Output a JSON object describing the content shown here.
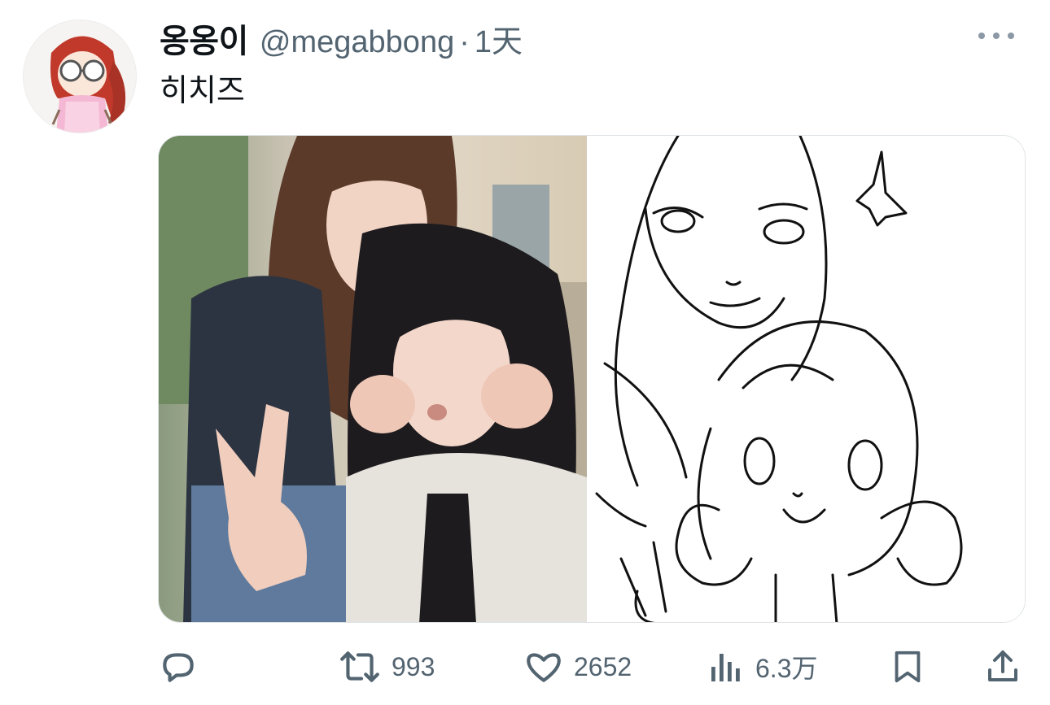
{
  "tweet": {
    "display_name": "옹옹이",
    "handle": "@megabbong",
    "separator": "·",
    "timestamp": "1天",
    "text": "히치즈"
  },
  "actions": {
    "reply": {
      "icon": "reply-icon",
      "count": ""
    },
    "retweet": {
      "icon": "retweet-icon",
      "count": "993"
    },
    "like": {
      "icon": "heart-icon",
      "count": "2652"
    },
    "views": {
      "icon": "views-icon",
      "count": "6.3万"
    },
    "bookmark": {
      "icon": "bookmark-icon"
    },
    "share": {
      "icon": "share-icon"
    }
  },
  "media": [
    {
      "kind": "photo",
      "description_icon": "photo-image"
    },
    {
      "kind": "line-drawing",
      "description_icon": "drawing-image"
    }
  ],
  "colors": {
    "text_primary": "#0f1419",
    "text_secondary": "#536471"
  }
}
